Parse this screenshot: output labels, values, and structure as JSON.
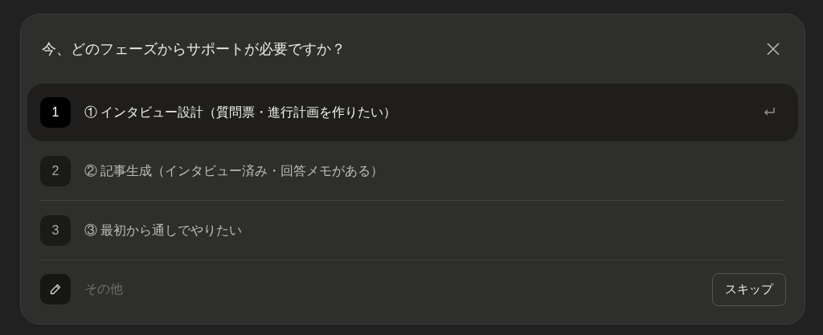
{
  "dialog": {
    "title": "今、どのフェーズからサポートが必要ですか？"
  },
  "options": [
    {
      "number": "1",
      "label": "① インタビュー設計（質問票・進行計画を作りたい）",
      "selected": true
    },
    {
      "number": "2",
      "label": "② 記事生成（インタビュー済み・回答メモがある）",
      "selected": false
    },
    {
      "number": "3",
      "label": "③ 最初から通しでやりたい",
      "selected": false
    }
  ],
  "other": {
    "placeholder": "その他"
  },
  "buttons": [
    "スキップ"
  ]
}
